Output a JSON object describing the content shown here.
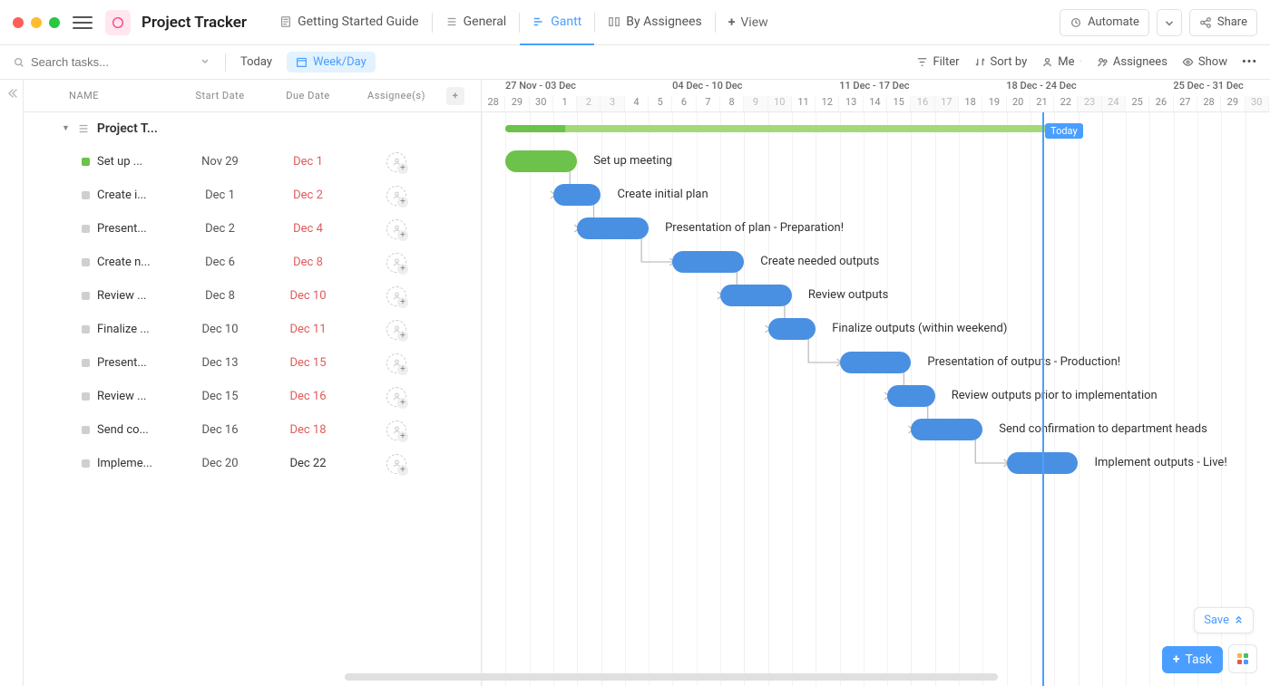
{
  "colors": {
    "blue": "#4a90e2",
    "green": "#6cc24a",
    "lightblue": "#4a9eff",
    "gray_dot": "#cfcfcf",
    "overdue": "#e05a5a"
  },
  "header": {
    "project_title": "Project Tracker",
    "tabs": [
      {
        "label": "Getting Started Guide",
        "icon": "doc",
        "active": false
      },
      {
        "label": "General",
        "icon": "list",
        "active": false
      },
      {
        "label": "Gantt",
        "icon": "gantt",
        "active": true
      },
      {
        "label": "By Assignees",
        "icon": "board",
        "active": false
      }
    ],
    "view_label": "View",
    "automate_label": "Automate",
    "share_label": "Share"
  },
  "toolbar": {
    "search_placeholder": "Search tasks...",
    "today_label": "Today",
    "scale_label": "Week/Day",
    "filter_label": "Filter",
    "sort_label": "Sort by",
    "me_label": "Me",
    "assignees_label": "Assignees",
    "show_label": "Show"
  },
  "columns": {
    "name": "NAME",
    "start": "Start Date",
    "due": "Due Date",
    "assignee": "Assignee(s)"
  },
  "group": {
    "title": "Project T..."
  },
  "tasks": [
    {
      "name": "Set up ...",
      "full": "Set up meeting",
      "start": "Nov 29",
      "due": "Dec 1",
      "overdue": true,
      "color": "#6cc24a",
      "bar_start": 1,
      "bar_end": 4
    },
    {
      "name": "Create i...",
      "full": "Create initial plan",
      "start": "Dec 1",
      "due": "Dec 2",
      "overdue": true,
      "color": "#cfcfcf",
      "bar_start": 3,
      "bar_end": 5
    },
    {
      "name": "Present...",
      "full": "Presentation of plan - Preparation!",
      "start": "Dec 2",
      "due": "Dec 4",
      "overdue": true,
      "color": "#cfcfcf",
      "bar_start": 4,
      "bar_end": 7
    },
    {
      "name": "Create n...",
      "full": "Create needed outputs",
      "start": "Dec 6",
      "due": "Dec 8",
      "overdue": true,
      "color": "#cfcfcf",
      "bar_start": 8,
      "bar_end": 11
    },
    {
      "name": "Review ...",
      "full": "Review outputs",
      "start": "Dec 8",
      "due": "Dec 10",
      "overdue": true,
      "color": "#cfcfcf",
      "bar_start": 10,
      "bar_end": 13
    },
    {
      "name": "Finalize ...",
      "full": "Finalize outputs (within weekend)",
      "start": "Dec 10",
      "due": "Dec 11",
      "overdue": true,
      "color": "#cfcfcf",
      "bar_start": 12,
      "bar_end": 14
    },
    {
      "name": "Present...",
      "full": "Presentation of outputs - Production!",
      "start": "Dec 13",
      "due": "Dec 15",
      "overdue": true,
      "color": "#cfcfcf",
      "bar_start": 15,
      "bar_end": 18
    },
    {
      "name": "Review ...",
      "full": "Review outputs prior to implementation",
      "start": "Dec 15",
      "due": "Dec 16",
      "overdue": true,
      "color": "#cfcfcf",
      "bar_start": 17,
      "bar_end": 19
    },
    {
      "name": "Send co...",
      "full": "Send confirmation to department heads",
      "start": "Dec 16",
      "due": "Dec 18",
      "overdue": true,
      "color": "#cfcfcf",
      "bar_start": 18,
      "bar_end": 21
    },
    {
      "name": "Impleme...",
      "full": "Implement outputs - Live!",
      "start": "Dec 20",
      "due": "Dec 22",
      "overdue": false,
      "color": "#cfcfcf",
      "bar_start": 22,
      "bar_end": 25
    }
  ],
  "timeline": {
    "today_label": "Today",
    "today_index": 23,
    "weeks": [
      {
        "label": "27 Nov - 03 Dec",
        "start_index": 0
      },
      {
        "label": "04 Dec - 10 Dec",
        "start_index": 7
      },
      {
        "label": "11 Dec - 17 Dec",
        "start_index": 14
      },
      {
        "label": "18 Dec - 24 Dec",
        "start_index": 21
      },
      {
        "label": "25 Dec - 31 Dec",
        "start_index": 28
      }
    ],
    "days": [
      {
        "n": "28",
        "wk": false
      },
      {
        "n": "29",
        "wk": false
      },
      {
        "n": "30",
        "wk": false
      },
      {
        "n": "1",
        "wk": false
      },
      {
        "n": "2",
        "wk": true
      },
      {
        "n": "3",
        "wk": true
      },
      {
        "n": "4",
        "wk": false
      },
      {
        "n": "5",
        "wk": false
      },
      {
        "n": "6",
        "wk": false
      },
      {
        "n": "7",
        "wk": false
      },
      {
        "n": "8",
        "wk": false
      },
      {
        "n": "9",
        "wk": true
      },
      {
        "n": "10",
        "wk": true
      },
      {
        "n": "11",
        "wk": false
      },
      {
        "n": "12",
        "wk": false
      },
      {
        "n": "13",
        "wk": false
      },
      {
        "n": "14",
        "wk": false
      },
      {
        "n": "15",
        "wk": false
      },
      {
        "n": "16",
        "wk": true
      },
      {
        "n": "17",
        "wk": true
      },
      {
        "n": "18",
        "wk": false
      },
      {
        "n": "19",
        "wk": false
      },
      {
        "n": "20",
        "wk": false
      },
      {
        "n": "21",
        "wk": false
      },
      {
        "n": "22",
        "wk": false
      },
      {
        "n": "23",
        "wk": true
      },
      {
        "n": "24",
        "wk": true
      },
      {
        "n": "25",
        "wk": false
      },
      {
        "n": "26",
        "wk": false
      },
      {
        "n": "27",
        "wk": false
      },
      {
        "n": "28",
        "wk": false
      },
      {
        "n": "29",
        "wk": false
      },
      {
        "n": "30",
        "wk": true
      }
    ],
    "summary": {
      "start_index": 1,
      "end_index": 25,
      "progress_end_index": 3.5
    }
  },
  "footer": {
    "save_label": "Save",
    "task_button": "Task"
  },
  "chart_data": {
    "type": "gantt",
    "title": "Project Tracker",
    "x_range": [
      "2023-11-28",
      "2023-12-30"
    ],
    "today": "2023-12-21",
    "tasks": [
      {
        "name": "Set up meeting",
        "start": "2023-11-29",
        "end": "2023-12-01",
        "status": "done",
        "predecessor": null
      },
      {
        "name": "Create initial plan",
        "start": "2023-12-01",
        "end": "2023-12-02",
        "status": "open",
        "predecessor": 0
      },
      {
        "name": "Presentation of plan - Preparation!",
        "start": "2023-12-02",
        "end": "2023-12-04",
        "status": "open",
        "predecessor": 1
      },
      {
        "name": "Create needed outputs",
        "start": "2023-12-06",
        "end": "2023-12-08",
        "status": "open",
        "predecessor": 2
      },
      {
        "name": "Review outputs",
        "start": "2023-12-08",
        "end": "2023-12-10",
        "status": "open",
        "predecessor": 3
      },
      {
        "name": "Finalize outputs (within weekend)",
        "start": "2023-12-10",
        "end": "2023-12-11",
        "status": "open",
        "predecessor": 4
      },
      {
        "name": "Presentation of outputs - Production!",
        "start": "2023-12-13",
        "end": "2023-12-15",
        "status": "open",
        "predecessor": 5
      },
      {
        "name": "Review outputs prior to implementation",
        "start": "2023-12-15",
        "end": "2023-12-16",
        "status": "open",
        "predecessor": 6
      },
      {
        "name": "Send confirmation to department heads",
        "start": "2023-12-16",
        "end": "2023-12-18",
        "status": "open",
        "predecessor": 7
      },
      {
        "name": "Implement outputs - Live!",
        "start": "2023-12-20",
        "end": "2023-12-22",
        "status": "open",
        "predecessor": 8
      }
    ]
  }
}
